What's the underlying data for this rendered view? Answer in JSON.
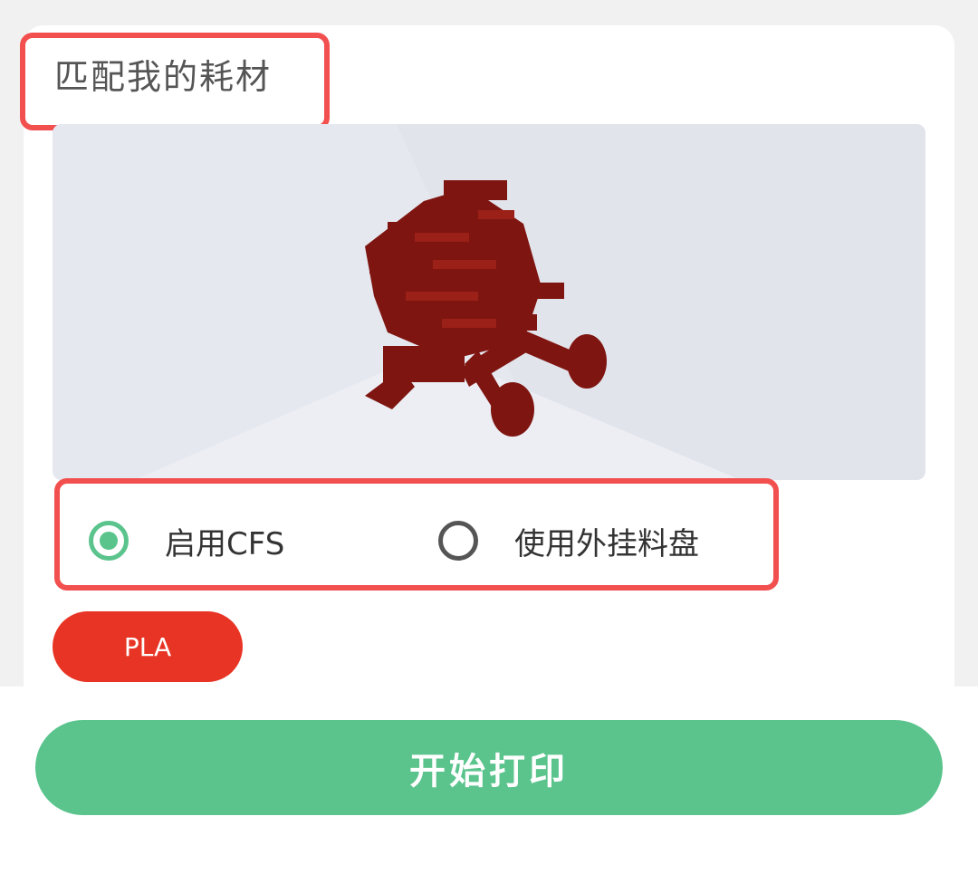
{
  "section": {
    "title": "匹配我的耗材"
  },
  "model_preview": {
    "model_color": "#7f1510",
    "background_color": "#e4e6ee"
  },
  "feed_mode": {
    "options": [
      {
        "label": "启用CFS",
        "selected": true
      },
      {
        "label": "使用外挂料盘",
        "selected": false
      }
    ]
  },
  "filament": {
    "material_label": "PLA",
    "color": "#e83424"
  },
  "actions": {
    "start_print_label": "开始打印"
  },
  "colors": {
    "accent": "#5bc48d",
    "highlight": "#f24f4f"
  }
}
